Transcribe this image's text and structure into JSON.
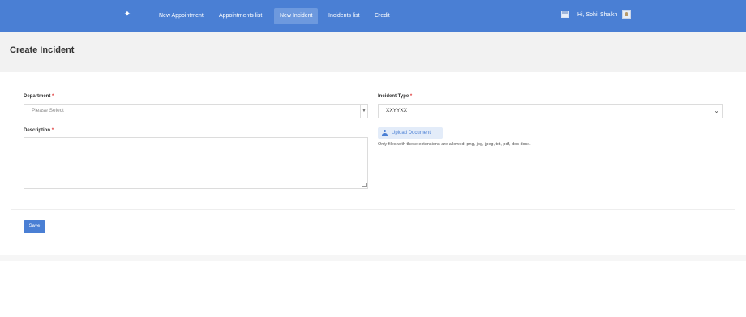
{
  "header": {
    "logo_icon": "leaf-icon",
    "nav": [
      {
        "label": "New Appointment"
      },
      {
        "label": "Appointments list"
      },
      {
        "label": "New Incident"
      },
      {
        "label": "Incidents list"
      },
      {
        "label": "Credit"
      }
    ],
    "active_nav": "New Incident",
    "flag_icon": "flag-icon",
    "user_label": "Hi, Sohil Shaikh",
    "avatar_icon": "user-avatar-icon",
    "brand_color": "#4a7fd4"
  },
  "page": {
    "title": "Create Incident"
  },
  "form": {
    "department": {
      "label": "Department",
      "required_mark": "*",
      "placeholder": "Please Select"
    },
    "incident_type": {
      "label": "Incident Type",
      "required_mark": "*",
      "value": "XXYYXX"
    },
    "description": {
      "label": "Description",
      "required_mark": "*"
    },
    "upload": {
      "label": "Upload Document",
      "help_text": "Only files with these extensions are allowed: png, jpg, jpeg, txt, pdf, doc docx."
    },
    "save_label": "Save"
  }
}
